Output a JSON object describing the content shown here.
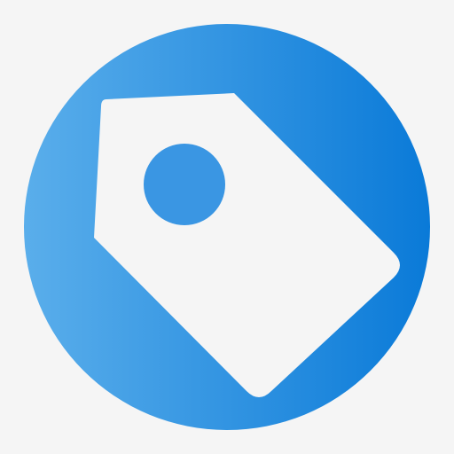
{
  "icon": {
    "semantic_name": "price-tag-icon",
    "colors": {
      "background": "#f5f5f5",
      "circle_gradient_start": "#5aaeeb",
      "circle_gradient_end": "#0a7ad8",
      "tag_fill": "#f5f5f5",
      "hole_fill": "#3a96e3"
    }
  }
}
